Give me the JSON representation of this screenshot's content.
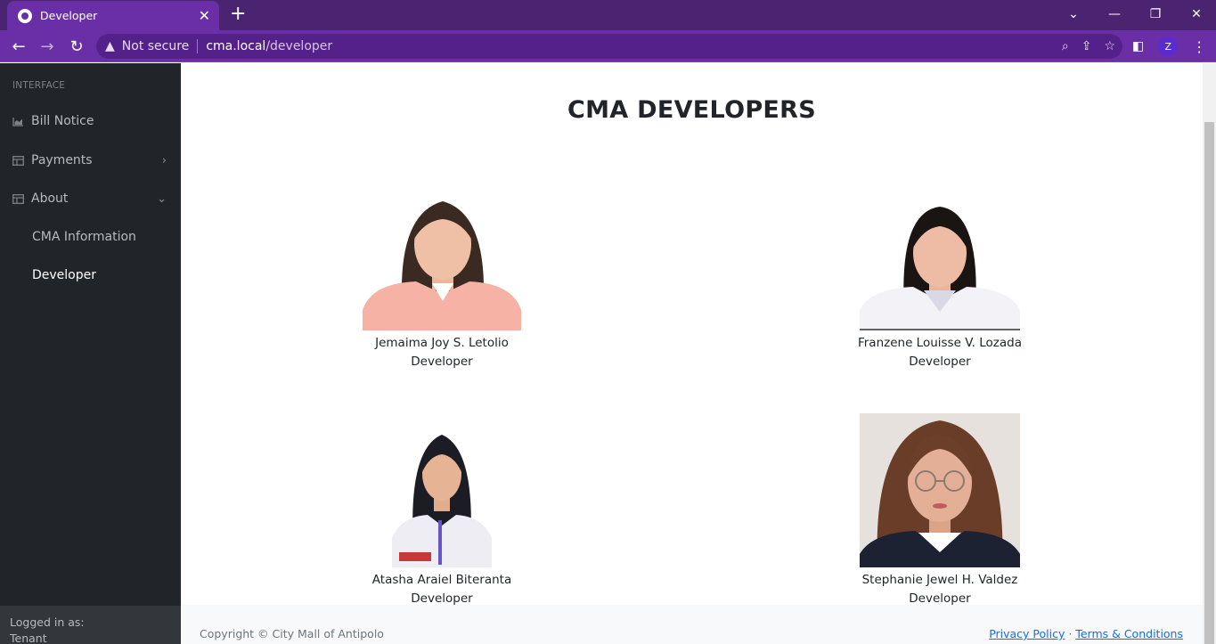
{
  "browser": {
    "tab_title": "Developer",
    "security_label": "Not secure",
    "url_host": "cma.local",
    "url_path": "/developer",
    "profile_initial": "Z",
    "accent": "#6a2fa6"
  },
  "sidebar": {
    "heading": "INTERFACE",
    "items": [
      {
        "label": "Bill Notice",
        "icon": "chart-area-icon"
      },
      {
        "label": "Payments",
        "icon": "table-icon"
      },
      {
        "label": "About",
        "icon": "table-icon"
      }
    ],
    "sub_items": [
      {
        "label": "CMA Information"
      },
      {
        "label": "Developer"
      }
    ],
    "footer_label": "Logged in as:",
    "footer_user": "Tenant"
  },
  "main": {
    "title": "CMA DEVELOPERS",
    "developers": [
      {
        "name": "Jemaima Joy S. Letolio",
        "role": "Developer"
      },
      {
        "name": "Franzene Louisse V. Lozada",
        "role": "Developer"
      },
      {
        "name": "Atasha Araiel Biteranta",
        "role": "Developer"
      },
      {
        "name": "Stephanie Jewel H. Valdez",
        "role": "Developer"
      }
    ]
  },
  "footer": {
    "copyright": "Copyright © City Mall of Antipolo",
    "privacy": "Privacy Policy",
    "separator": "·",
    "terms": "Terms & Conditions"
  }
}
